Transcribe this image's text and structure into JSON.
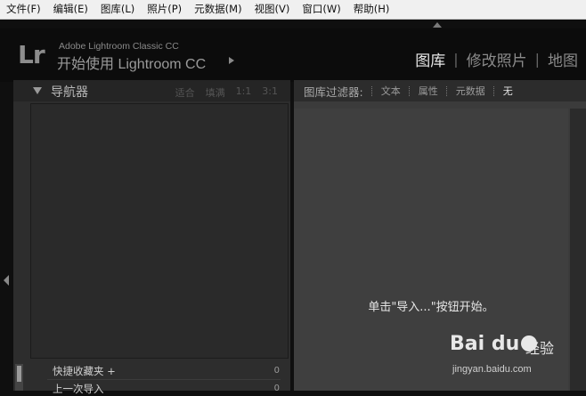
{
  "menubar": {
    "items": [
      "文件(F)",
      "编辑(E)",
      "图库(L)",
      "照片(P)",
      "元数据(M)",
      "视图(V)",
      "窗口(W)",
      "帮助(H)"
    ]
  },
  "identity": {
    "logo": "Lr",
    "product": "Adobe Lightroom Classic CC",
    "tagline": "开始使用 Lightroom CC"
  },
  "modules": {
    "items": [
      "图库",
      "修改照片",
      "地图"
    ],
    "active": "图库"
  },
  "navigator": {
    "title": "导航器",
    "options": [
      "适合",
      "填满",
      "1:1",
      "3:1"
    ]
  },
  "collections": [
    {
      "label": "快捷收藏夹 +",
      "count": "0"
    },
    {
      "label": "上一次导入",
      "count": "0"
    }
  ],
  "filter": {
    "title": "图库过滤器:",
    "options": [
      "文本",
      "属性",
      "元数据",
      "无"
    ],
    "active": "无"
  },
  "grid": {
    "prompt": "单击\"导入...\"按钮开始。"
  },
  "watermark": {
    "logo": "Bai du",
    "text": "经验",
    "url": "jingyan.baidu.com"
  }
}
